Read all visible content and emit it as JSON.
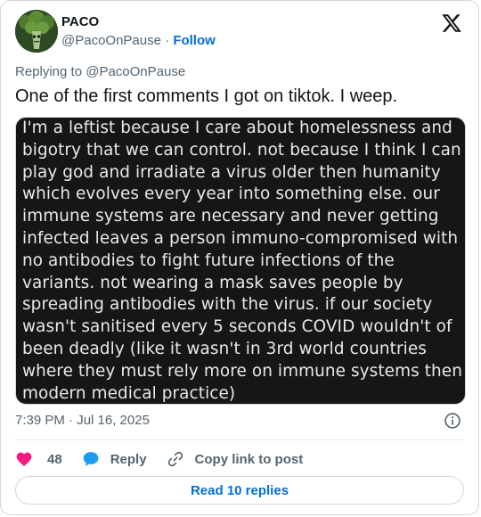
{
  "author": {
    "name": "PACO",
    "handle": "@PacoOnPause",
    "separator": "·",
    "follow_label": "Follow"
  },
  "replying_to": "Replying to @PacoOnPause",
  "tweet_text": "One of the first comments I got on tiktok. I weep.",
  "media_lines": [
    "I'm a leftist because I care about homelessness and",
    "bigotry that we can control. not because I think I can",
    "play god and irradiate a virus older then humanity",
    "which evolves every year into something else. our",
    "immune systems are necessary and never getting",
    "infected leaves a person immuno-compromised with",
    "no antibodies to fight future infections of the",
    "variants. not wearing a mask saves people by",
    "spreading antibodies with the virus. if our society",
    "wasn't sanitised every 5 seconds COVID wouldn't of",
    "been deadly (like it wasn't in 3rd world countries",
    "where they must rely more on immune systems then",
    "modern medical practice)"
  ],
  "timestamp": "7:39 PM · Jul 16, 2025",
  "actions": {
    "like_count": "48",
    "reply_label": "Reply",
    "copy_link_label": "Copy link to post"
  },
  "read_replies_label": "Read 10 replies",
  "icons": {
    "avatar": "broccoli-avatar-icon",
    "logo": "x-logo-icon",
    "info": "info-icon",
    "like": "heart-icon",
    "reply": "speech-bubble-icon",
    "copy": "link-icon"
  },
  "colors": {
    "like": "#f91880",
    "reply": "#1d9bf0",
    "link_blue": "#006fd6",
    "muted": "#536471",
    "media_bg": "#161618"
  }
}
